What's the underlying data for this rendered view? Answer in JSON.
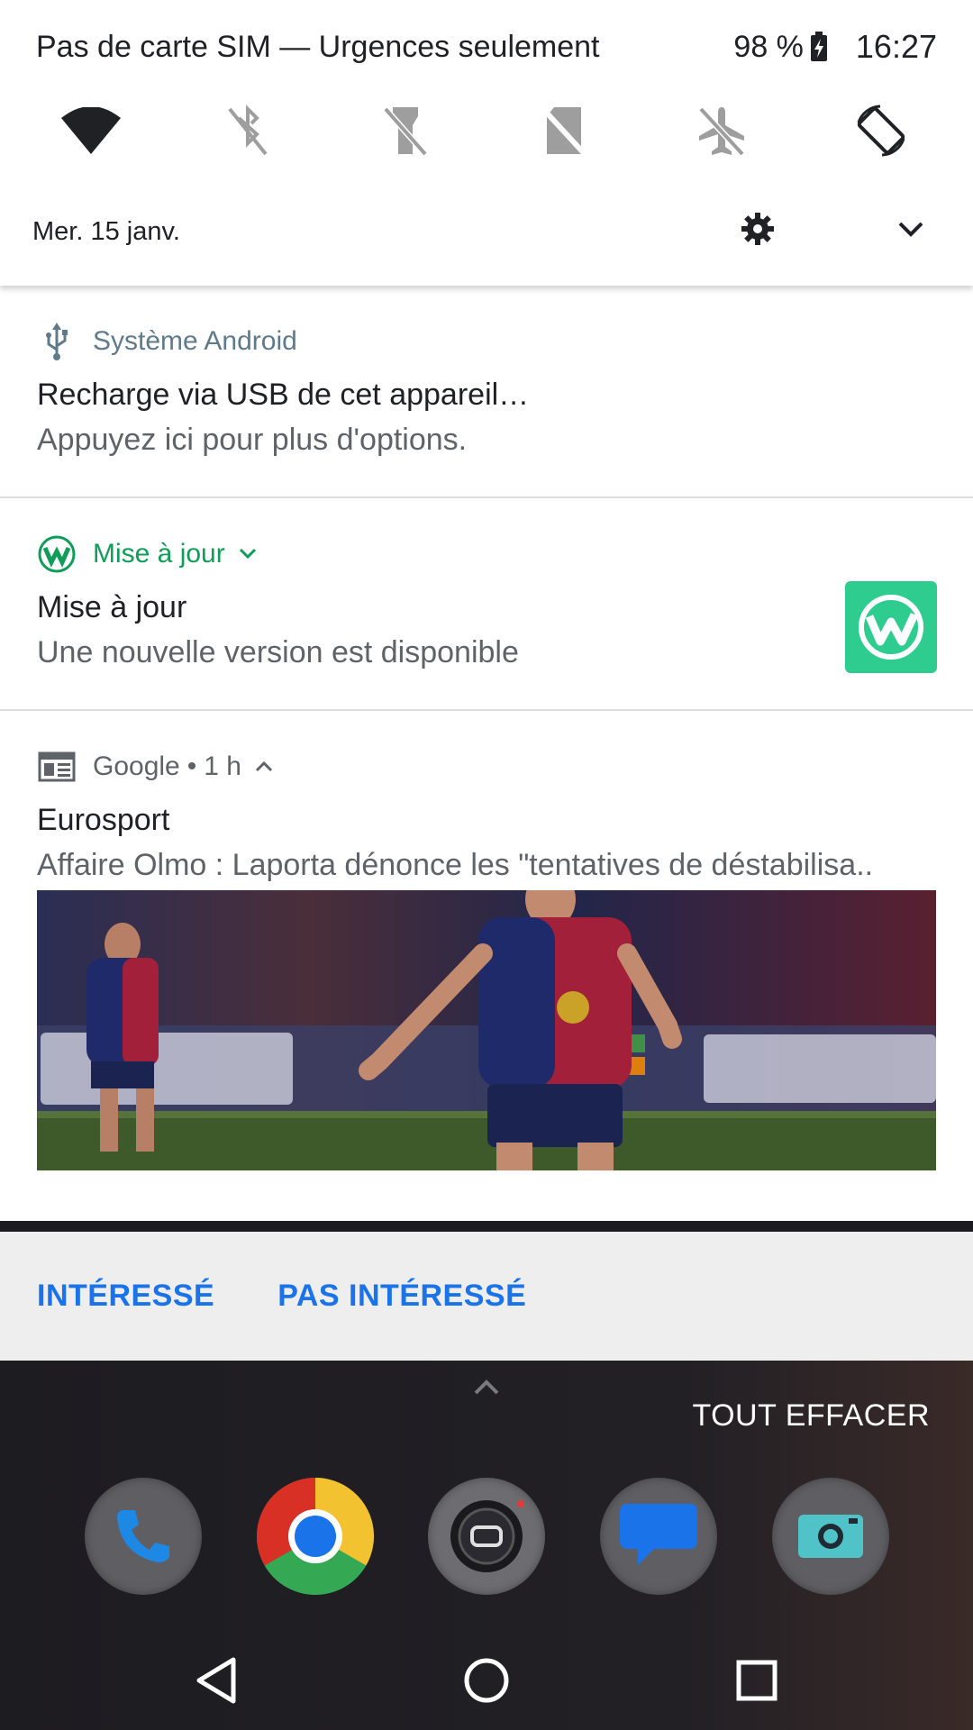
{
  "status_bar": {
    "carrier": "Pas de carte SIM — Urgences seulement",
    "battery": "98 %",
    "time": "16:27"
  },
  "quick_settings": {
    "tiles": [
      {
        "name": "wifi-icon",
        "state": "on"
      },
      {
        "name": "bluetooth-off-icon",
        "state": "off"
      },
      {
        "name": "flashlight-off-icon",
        "state": "off"
      },
      {
        "name": "mobile-data-off-icon",
        "state": "off"
      },
      {
        "name": "airplane-mode-off-icon",
        "state": "off"
      },
      {
        "name": "auto-rotate-icon",
        "state": "on"
      }
    ],
    "date": "Mer. 15 janv."
  },
  "notifications": {
    "usb": {
      "app": "Système Android",
      "title": "Recharge via USB de cet appareil…",
      "text": "Appuyez ici pour plus d'options.",
      "accent": "#5f7a8a"
    },
    "update": {
      "app": "Mise à jour",
      "title": "Mise à jour",
      "text": "Une nouvelle version est disponible",
      "accent": "#0f9d58"
    },
    "google": {
      "app": "Google",
      "age": "1 h",
      "title": "Eurosport",
      "text": "Affaire Olmo : Laporta dénonce les \"tentatives de déstabilisa..",
      "actions": [
        "INTÉRESSÉ",
        "PAS INTÉRESSÉ"
      ]
    }
  },
  "home": {
    "clear_all": "TOUT EFFACER",
    "dock": [
      "phone-app-icon",
      "chrome-app-icon",
      "camera-lens-app-icon",
      "messages-app-icon",
      "camera-app-icon"
    ]
  },
  "colors": {
    "action_blue": "#1a73e8",
    "update_green": "#2ecc8e"
  }
}
